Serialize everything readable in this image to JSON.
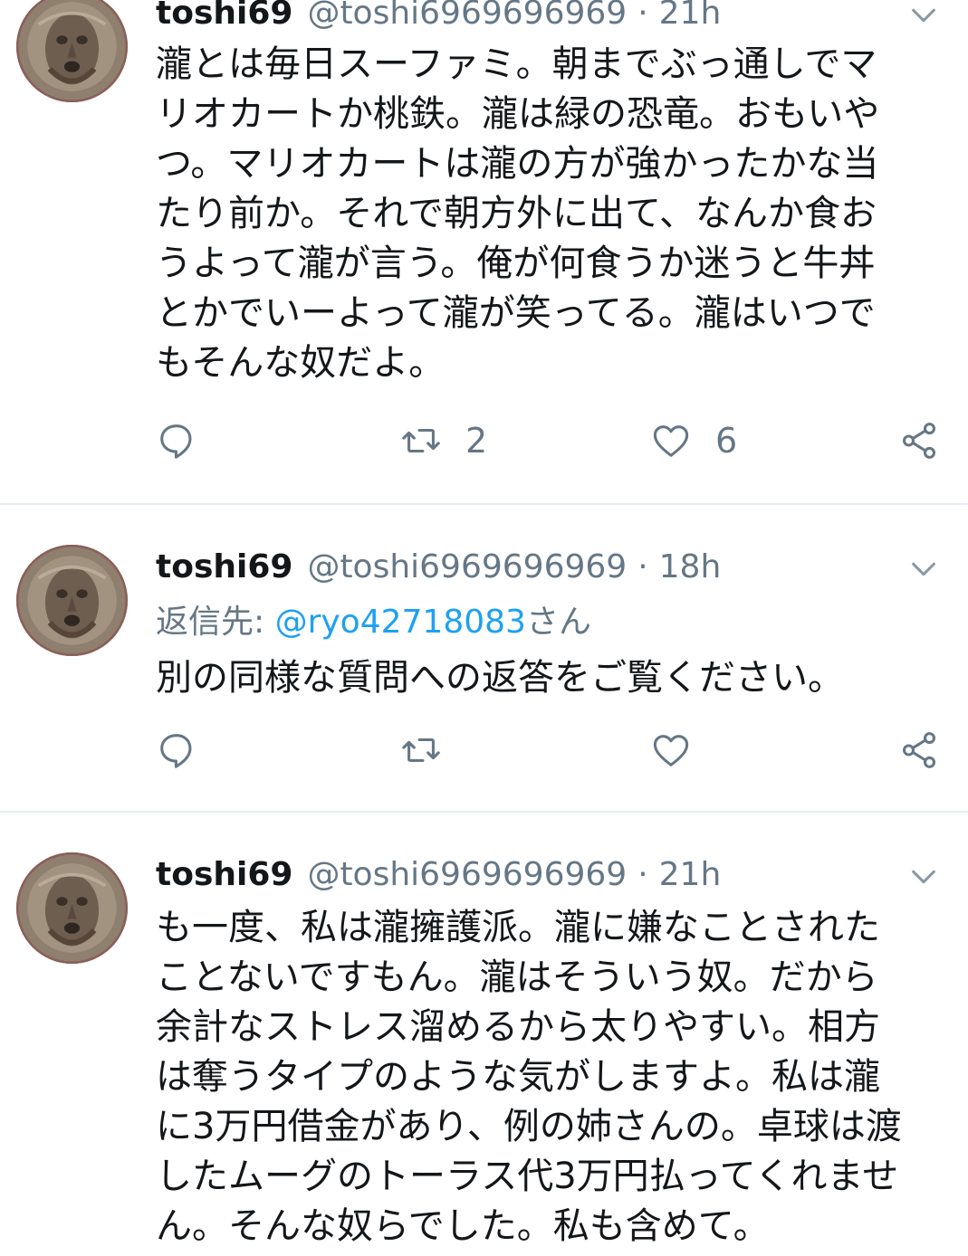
{
  "tweets": [
    {
      "name": "toshi69",
      "handle": "@toshi6969696969",
      "separator": "·",
      "time": "21h",
      "text": "瀧とは毎日スーファミ。朝までぶっ通しでマ\nリオカートか桃鉄。瀧は緑の恐竜。おもいや\nつ。マリオカートは瀧の方が強かったかな当\nたり前か。それで朝方外に出て、なんか食お\nうよって瀧が言う。俺が何食うか迷うと牛丼\nとかでいーよって瀧が笑ってる。瀧はいつで\nもそんな奴だよ。",
      "retweet_count": "2",
      "like_count": "6"
    },
    {
      "name": "toshi69",
      "handle": "@toshi6969696969",
      "separator": "·",
      "time": "18h",
      "reply_label": "返信先: ",
      "reply_mention": "@ryo42718083",
      "reply_suffix": "さん",
      "text": "別の同様な質問への返答をご覧ください。"
    },
    {
      "name": "toshi69",
      "handle": "@toshi6969696969",
      "separator": "·",
      "time": "21h",
      "text": "も一度、私は瀧擁護派。瀧に嫌なことされた\nことないですもん。瀧はそういう奴。だから\n余計なストレス溜めるから太りやすい。相方\nは奪うタイプのような気がしますよ。私は瀧\nに3万円借金があり、例の姉さんの。卓球は渡\nしたムーグのトーラス代3万円払ってくれませ\nん。そんな奴らでした。私も含めて。"
    }
  ],
  "icons": {
    "avatar": "avatar-image",
    "menu": "chevron-down-icon",
    "reply": "reply-icon",
    "retweet": "retweet-icon",
    "like": "heart-icon",
    "share": "share-icon"
  },
  "colors": {
    "text": "#14171a",
    "secondary": "#657786",
    "link": "#1da1f2",
    "divider": "#e6ecf0"
  }
}
